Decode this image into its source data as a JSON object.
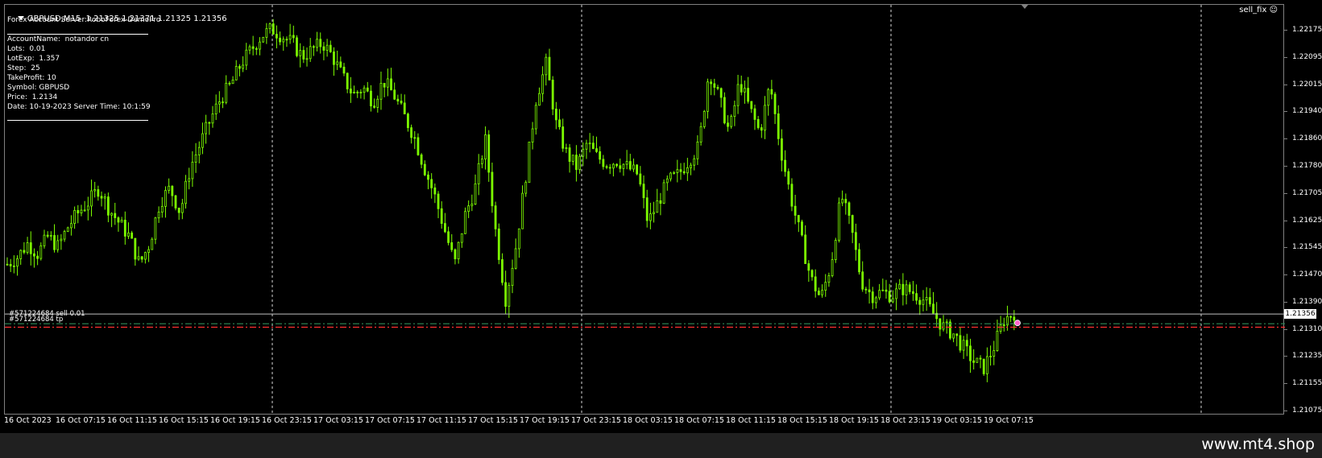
{
  "header": {
    "symbol_line": "GBPUSD,M15  1.21325 1.21371 1.21325 1.21356",
    "server_line": "Forex Account Server:RoboForex-DemoPro",
    "ea_badge": "sell_fix"
  },
  "info_panel": {
    "lines": [
      "AccountName:  notandor cn",
      "Lots:  0.01",
      "LotExp:  1.357",
      "Step:  25",
      "TakeProfit: 10",
      "Symbol: GBPUSD",
      "Price:  1.2134",
      "Date: 10-19-2023 Server Time: 10:1:59"
    ]
  },
  "orders": {
    "sell_label": "#571224684 sell 0.01",
    "tp_label": "#571224684 tp"
  },
  "price_axis": [
    "1.22175",
    "1.22095",
    "1.22015",
    "1.21940",
    "1.21860",
    "1.21780",
    "1.21705",
    "1.21625",
    "1.21545",
    "1.21470",
    "1.21390",
    "1.21310",
    "1.21235",
    "1.21155",
    "1.21075"
  ],
  "current_price": "1.21356",
  "time_axis": [
    "16 Oct 2023",
    "16 Oct 07:15",
    "16 Oct 11:15",
    "16 Oct 15:15",
    "16 Oct 19:15",
    "16 Oct 23:15",
    "17 Oct 03:15",
    "17 Oct 07:15",
    "17 Oct 11:15",
    "17 Oct 15:15",
    "17 Oct 19:15",
    "17 Oct 23:15",
    "18 Oct 03:15",
    "18 Oct 07:15",
    "18 Oct 11:15",
    "18 Oct 15:15",
    "18 Oct 19:15",
    "18 Oct 23:15",
    "19 Oct 03:15",
    "19 Oct 07:15"
  ],
  "footer": {
    "site": "www.mt4.shop"
  },
  "colors": {
    "candle": "#7CFC00",
    "bid_line": "#C0C0C0",
    "order_line": "#2E8B57",
    "tp_line": "#FF3030",
    "grid": "#FFFFFF"
  },
  "chart_data": {
    "type": "candlestick",
    "close_path": [
      1.215,
      1.2152,
      1.2156,
      1.2153,
      1.2158,
      1.2155,
      1.2161,
      1.2165,
      1.2168,
      1.2172,
      1.2166,
      1.2162,
      1.2158,
      1.215,
      1.2156,
      1.2168,
      1.2172,
      1.2165,
      1.2178,
      1.2185,
      1.2192,
      1.2198,
      1.2202,
      1.2208,
      1.2212,
      1.2216,
      1.2218,
      1.2216,
      1.2214,
      1.221,
      1.2212,
      1.2214,
      1.221,
      1.2204,
      1.2199,
      1.2201,
      1.2197,
      1.2203,
      1.2199,
      1.2193,
      1.2187,
      1.2178,
      1.217,
      1.216,
      1.215,
      1.2164,
      1.2172,
      1.2186,
      1.216,
      1.214,
      1.2155,
      1.2176,
      1.2198,
      1.2208,
      1.219,
      1.2182,
      1.2178,
      1.2185,
      1.2181,
      1.2179,
      1.218,
      1.2178,
      1.2176,
      1.2162,
      1.2168,
      1.2174,
      1.2176,
      1.218,
      1.2184,
      1.2206,
      1.2198,
      1.2188,
      1.2203,
      1.2195,
      1.2188,
      1.2202,
      1.2184,
      1.217,
      1.2158,
      1.2146,
      1.214,
      1.215,
      1.217,
      1.216,
      1.2145,
      1.2141,
      1.2142,
      1.2141,
      1.2143,
      1.2142,
      1.214,
      1.2136,
      1.2132,
      1.213,
      1.2126,
      1.2122,
      1.212,
      1.2126,
      1.2134,
      1.2136
    ],
    "ylim": [
      1.21075,
      1.22175
    ]
  }
}
